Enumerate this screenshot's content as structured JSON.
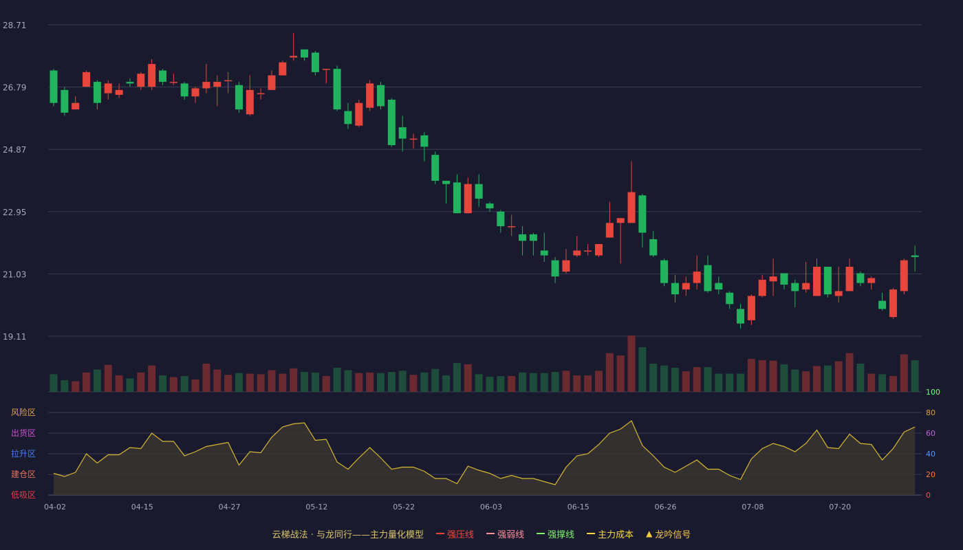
{
  "colors": {
    "background": "#191a2e",
    "up": "#e8453c",
    "down": "#22b35e",
    "vol_up": "#6b2a30",
    "vol_down": "#1f4d3c",
    "grid": "#3a3c52",
    "tick_text": "#a7a9b8",
    "oscillator_line": "#d7b92f",
    "oscillator_fill": "#3a3530"
  },
  "legend": {
    "title": "云梯战法 · 与龙同行——主力量化模型",
    "items": [
      {
        "label": "强压线",
        "color": "#f04a3f",
        "style": "solid",
        "icon": "line-swatch"
      },
      {
        "label": "强弱线",
        "color": "#ff8f9a",
        "style": "dashed",
        "icon": "dashed-line-swatch"
      },
      {
        "label": "强撑线",
        "color": "#7cf36b",
        "style": "solid",
        "icon": "line-swatch"
      },
      {
        "label": "主力成本",
        "color": "#f5d83b",
        "style": "dashed",
        "icon": "dashed-line-swatch"
      },
      {
        "label": "龙吟信号",
        "color": "#f5c842",
        "style": "triangle",
        "icon": "triangle-icon"
      }
    ]
  },
  "chart_data": [
    {
      "type": "candlestick",
      "y_ticks": [
        "28.71",
        "26.79",
        "24.87",
        "22.95",
        "21.03",
        "19.11"
      ],
      "ylim": [
        19.11,
        28.71
      ],
      "grid": true,
      "x_tick_labels": [
        "04-02",
        "04-15",
        "04-27",
        "05-12",
        "05-22",
        "06-03",
        "06-15",
        "06-26",
        "07-08",
        "07-20"
      ],
      "x_tick_index": [
        0,
        8,
        16,
        24,
        32,
        40,
        48,
        56,
        64,
        72
      ],
      "candles": [
        [
          27.3,
          26.3,
          27.35,
          26.2
        ],
        [
          26.7,
          26.0,
          26.8,
          25.9
        ],
        [
          26.1,
          26.3,
          26.5,
          26.1
        ],
        [
          26.8,
          27.25,
          27.3,
          26.8
        ],
        [
          26.95,
          26.3,
          27.0,
          26.1
        ],
        [
          26.6,
          26.9,
          27.0,
          26.4
        ],
        [
          26.55,
          26.7,
          26.9,
          26.45
        ],
        [
          26.95,
          26.9,
          27.05,
          26.8
        ],
        [
          26.8,
          27.2,
          27.25,
          26.7
        ],
        [
          26.8,
          27.5,
          27.65,
          26.7
        ],
        [
          27.3,
          26.95,
          27.35,
          26.85
        ],
        [
          26.95,
          26.95,
          27.2,
          26.85
        ],
        [
          26.9,
          26.5,
          26.95,
          26.4
        ],
        [
          26.5,
          26.75,
          26.8,
          26.3
        ],
        [
          26.75,
          26.95,
          27.5,
          26.6
        ],
        [
          26.8,
          26.95,
          27.15,
          26.2
        ],
        [
          27.0,
          27.0,
          27.25,
          26.6
        ],
        [
          26.85,
          26.1,
          26.95,
          26.0
        ],
        [
          25.95,
          26.7,
          27.15,
          25.9
        ],
        [
          26.6,
          26.6,
          26.75,
          26.4
        ],
        [
          26.7,
          27.15,
          27.3,
          26.7
        ],
        [
          27.15,
          27.55,
          27.6,
          27.15
        ],
        [
          27.7,
          27.75,
          28.45,
          27.6
        ],
        [
          27.95,
          27.7,
          27.95,
          27.6
        ],
        [
          27.85,
          27.25,
          27.9,
          27.15
        ],
        [
          27.35,
          27.35,
          27.35,
          26.9
        ],
        [
          27.35,
          26.1,
          27.45,
          26.05
        ],
        [
          26.05,
          25.65,
          26.3,
          25.5
        ],
        [
          25.6,
          26.3,
          26.4,
          25.55
        ],
        [
          26.15,
          26.9,
          27.0,
          26.05
        ],
        [
          26.85,
          26.2,
          26.95,
          26.1
        ],
        [
          26.4,
          25.0,
          26.45,
          24.95
        ],
        [
          25.55,
          25.2,
          25.9,
          24.8
        ],
        [
          25.2,
          25.2,
          25.35,
          24.9
        ],
        [
          25.3,
          24.95,
          25.4,
          24.5
        ],
        [
          24.7,
          23.9,
          24.8,
          23.8
        ],
        [
          23.9,
          23.8,
          23.9,
          23.2
        ],
        [
          23.85,
          22.9,
          24.1,
          22.9
        ],
        [
          22.9,
          23.8,
          24.0,
          22.9
        ],
        [
          23.8,
          23.35,
          24.1,
          23.1
        ],
        [
          23.2,
          23.05,
          23.25,
          22.95
        ],
        [
          22.95,
          22.5,
          23.0,
          22.3
        ],
        [
          22.5,
          22.5,
          22.85,
          22.2
        ],
        [
          22.25,
          22.05,
          22.5,
          21.6
        ],
        [
          22.25,
          22.05,
          22.3,
          21.6
        ],
        [
          21.75,
          21.6,
          22.3,
          21.4
        ],
        [
          21.45,
          20.95,
          21.55,
          20.75
        ],
        [
          21.1,
          21.45,
          21.8,
          21.05
        ],
        [
          21.6,
          21.75,
          22.2,
          21.55
        ],
        [
          21.75,
          21.75,
          21.95,
          21.6
        ],
        [
          21.6,
          21.95,
          21.95,
          21.55
        ],
        [
          22.15,
          22.6,
          23.25,
          22.15
        ],
        [
          22.6,
          22.75,
          22.75,
          21.35
        ],
        [
          22.6,
          23.55,
          24.5,
          22.6
        ],
        [
          23.45,
          22.3,
          23.5,
          21.85
        ],
        [
          22.1,
          21.6,
          22.35,
          21.55
        ],
        [
          21.45,
          20.75,
          21.5,
          20.65
        ],
        [
          20.75,
          20.4,
          21.0,
          20.15
        ],
        [
          20.55,
          20.75,
          20.95,
          20.35
        ],
        [
          20.75,
          21.1,
          21.6,
          20.55
        ],
        [
          21.3,
          20.5,
          21.6,
          20.45
        ],
        [
          20.75,
          20.55,
          20.95,
          20.4
        ],
        [
          20.45,
          20.1,
          20.5,
          19.95
        ],
        [
          19.95,
          19.5,
          20.1,
          19.35
        ],
        [
          19.6,
          20.35,
          20.4,
          19.45
        ],
        [
          20.35,
          20.85,
          21.0,
          20.3
        ],
        [
          20.8,
          20.95,
          21.5,
          20.35
        ],
        [
          21.05,
          20.7,
          21.05,
          20.55
        ],
        [
          20.75,
          20.5,
          20.85,
          20.0
        ],
        [
          20.55,
          20.75,
          21.4,
          20.45
        ],
        [
          20.35,
          21.25,
          21.5,
          20.35
        ],
        [
          21.25,
          20.4,
          21.25,
          20.3
        ],
        [
          20.35,
          20.5,
          21.25,
          20.15
        ],
        [
          20.5,
          21.25,
          21.5,
          20.5
        ],
        [
          21.05,
          20.75,
          21.1,
          20.65
        ],
        [
          20.75,
          20.9,
          20.95,
          20.55
        ],
        [
          20.2,
          19.95,
          20.45,
          19.9
        ],
        [
          19.7,
          20.55,
          20.6,
          19.65
        ],
        [
          20.5,
          21.45,
          21.5,
          20.4
        ],
        [
          21.6,
          21.55,
          21.9,
          21.1
        ]
      ],
      "volumes": [
        30,
        20,
        18,
        33,
        38,
        46,
        28,
        23,
        33,
        45,
        28,
        25,
        27,
        21,
        48,
        38,
        29,
        32,
        31,
        30,
        37,
        31,
        40,
        34,
        33,
        27,
        41,
        37,
        32,
        33,
        32,
        34,
        36,
        29,
        33,
        39,
        28,
        49,
        47,
        30,
        26,
        27,
        27,
        33,
        32,
        32,
        34,
        36,
        28,
        28,
        36,
        66,
        62,
        96,
        76,
        48,
        45,
        41,
        35,
        42,
        42,
        31,
        31,
        31,
        56,
        54,
        53,
        47,
        38,
        35,
        44,
        45,
        52,
        66,
        48,
        31,
        30,
        27,
        64,
        54
      ]
    },
    {
      "type": "area",
      "y_ticks": [
        0,
        20,
        40,
        60,
        80,
        100
      ],
      "ylim": [
        0,
        100
      ],
      "zone_labels": [
        {
          "label": "风险区",
          "color": "#d9a640"
        },
        {
          "label": "出货区",
          "color": "#d14fd1"
        },
        {
          "label": "拉升区",
          "color": "#4a7ee8"
        },
        {
          "label": "建仓区",
          "color": "#e8705a"
        },
        {
          "label": "低吸区",
          "color": "#e23c4a"
        }
      ],
      "tick_colors": [
        "#ff4a4a",
        "#ff7a3c",
        "#4a9eff",
        "#c85fd9",
        "#e0a030",
        "#6cff6c"
      ],
      "values": [
        21,
        18,
        22,
        40,
        31,
        39,
        39,
        46,
        45,
        60,
        52,
        52,
        38,
        42,
        47,
        49,
        51,
        29,
        42,
        41,
        56,
        66,
        69,
        70,
        53,
        54,
        32,
        25,
        36,
        46,
        36,
        25,
        27,
        27,
        23,
        16,
        16,
        11,
        28,
        24,
        21,
        16,
        19,
        16,
        16,
        13,
        10,
        27,
        38,
        40,
        49,
        60,
        64,
        72,
        48,
        38,
        27,
        22,
        28,
        34,
        25,
        25,
        19,
        15,
        35,
        45,
        50,
        47,
        42,
        50,
        63,
        46,
        45,
        59,
        50,
        49,
        34,
        45,
        61,
        66
      ]
    }
  ]
}
